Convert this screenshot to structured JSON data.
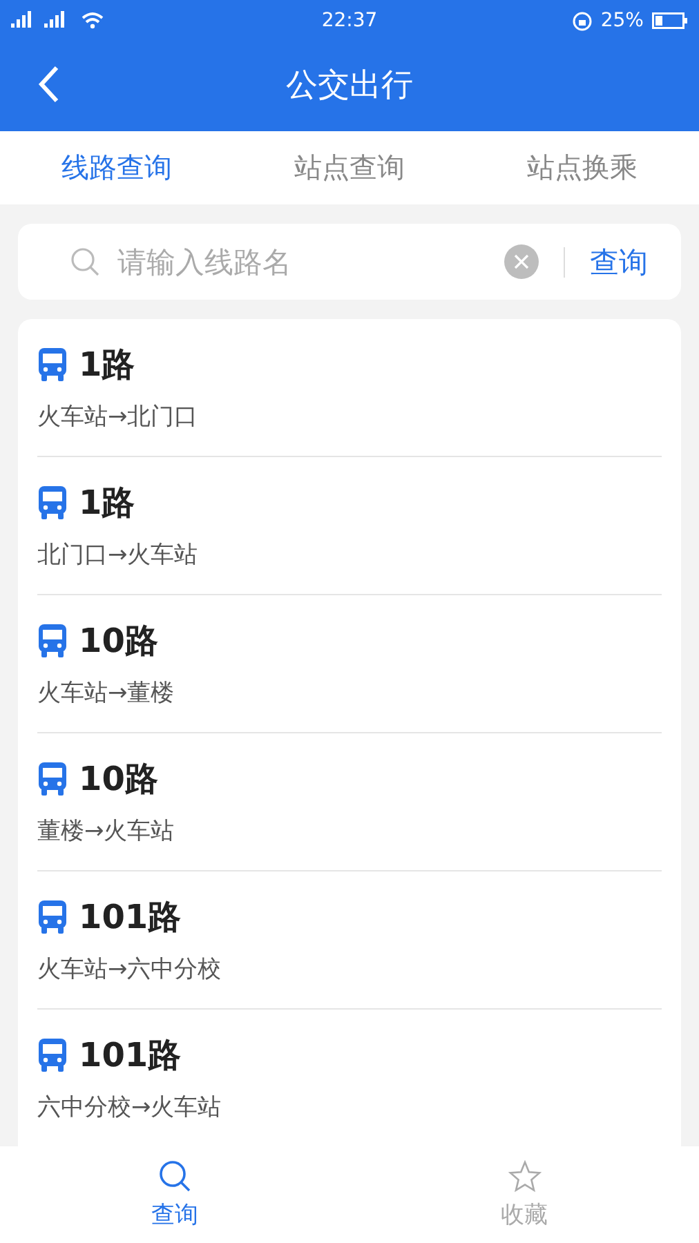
{
  "status_bar": {
    "time": "22:37",
    "battery": "25%"
  },
  "header": {
    "title": "公交出行"
  },
  "tabs": [
    {
      "label": "线路查询",
      "selected": true
    },
    {
      "label": "站点查询",
      "selected": false
    },
    {
      "label": "站点换乘",
      "selected": false
    }
  ],
  "search": {
    "placeholder": "请输入线路名",
    "button": "查询"
  },
  "routes": [
    {
      "name": "1路",
      "direction": "火车站→北门口"
    },
    {
      "name": "1路",
      "direction": "北门口→火车站"
    },
    {
      "name": "10路",
      "direction": "火车站→董楼"
    },
    {
      "name": "10路",
      "direction": "董楼→火车站"
    },
    {
      "name": "101路",
      "direction": "火车站→六中分校"
    },
    {
      "name": "101路",
      "direction": "六中分校→火车站"
    }
  ],
  "bottom_nav": [
    {
      "label": "查询",
      "kind": "search",
      "selected": true
    },
    {
      "label": "收藏",
      "kind": "favorites",
      "selected": false
    }
  ]
}
